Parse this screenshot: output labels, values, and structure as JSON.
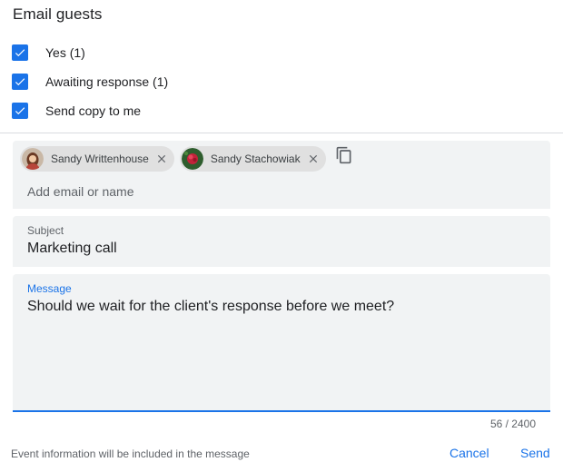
{
  "dialog": {
    "title": "Email guests"
  },
  "filters": [
    {
      "label": "Yes (1)",
      "checked": true
    },
    {
      "label": "Awaiting response (1)",
      "checked": true
    },
    {
      "label": "Send copy to me",
      "checked": true
    }
  ],
  "recipients": {
    "chips": [
      {
        "name": "Sandy Writtenhouse",
        "avatar": "woman-avatar-icon"
      },
      {
        "name": "Sandy Stachowiak",
        "avatar": "flower-avatar-icon"
      }
    ],
    "copy_icon": "copy-icon",
    "placeholder": "Add email or name"
  },
  "subject": {
    "label": "Subject",
    "value": "Marketing call"
  },
  "message": {
    "label": "Message",
    "value": "Should we wait for the client's response before we meet?"
  },
  "counter": "56 / 2400",
  "footer": {
    "note": "Event information will be included in the message",
    "cancel_label": "Cancel",
    "send_label": "Send"
  },
  "colors": {
    "accent": "#1a73e8",
    "field_bg": "#f1f3f4",
    "chip_bg": "#e0e0e0"
  }
}
